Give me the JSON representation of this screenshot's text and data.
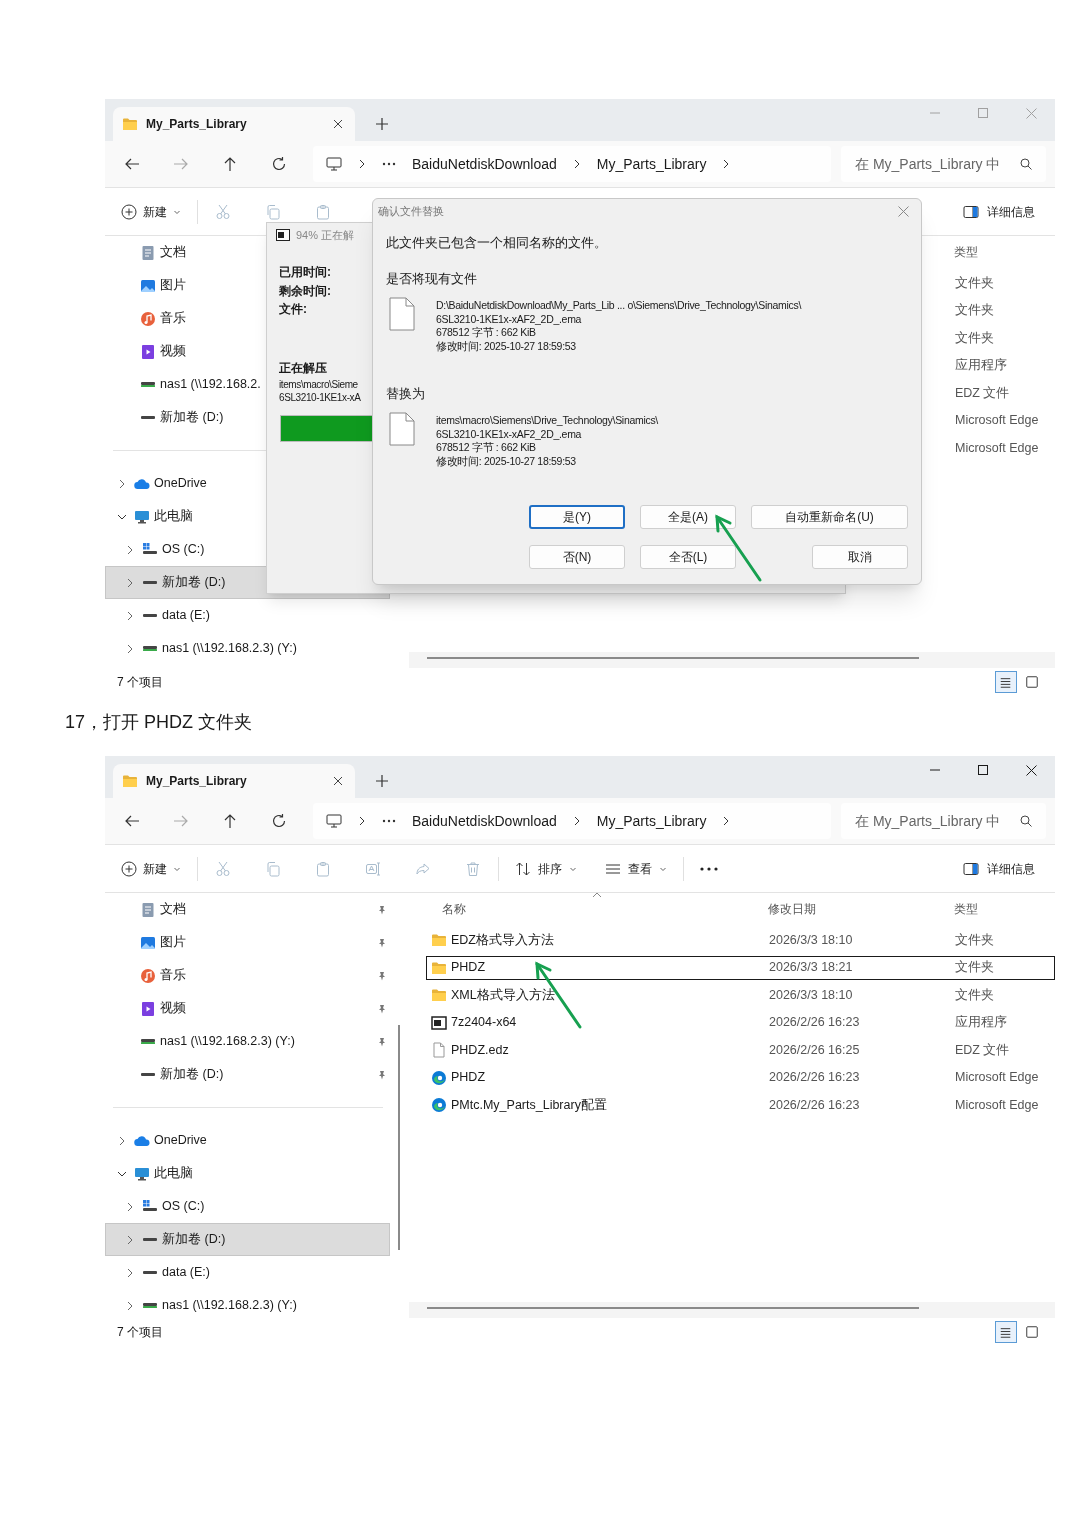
{
  "screenshot_1": {
    "active": false,
    "tab": {
      "title": "My_Parts_Library"
    },
    "breadcrumbs": [
      "BaiduNetdiskDownload",
      "My_Parts_Library"
    ],
    "search": {
      "placeholder": "在 My_Parts_Library 中"
    },
    "toolbar": {
      "new_label": "新建",
      "actions": [
        {
          "kind": "cut",
          "disabled": true
        },
        {
          "kind": "copy",
          "disabled": true
        },
        {
          "kind": "paste",
          "disabled": true
        }
      ],
      "details_label": "详细信息"
    },
    "sidebar": {
      "quick_access": [
        {
          "kind": "documents",
          "label": "文档"
        },
        {
          "kind": "pictures",
          "label": "图片"
        },
        {
          "kind": "music",
          "label": "音乐"
        },
        {
          "kind": "videos",
          "label": "视频"
        },
        {
          "kind": "network-drive",
          "label": "nas1 (\\\\192.168.2."
        },
        {
          "kind": "drive",
          "label": "新加卷 (D:)"
        }
      ],
      "tree": [
        {
          "kind": "cloud",
          "label": "OneDrive",
          "expanded": false,
          "selected": false
        },
        {
          "kind": "computer",
          "label": "此电脑",
          "expanded": true,
          "selected": false,
          "children": [
            {
              "kind": "windows-drive",
              "label": "OS (C:)",
              "expanded": false,
              "selected": false
            },
            {
              "kind": "drive",
              "label": "新加卷 (D:)",
              "expanded": false,
              "selected": true
            },
            {
              "kind": "drive",
              "label": "data (E:)",
              "expanded": false,
              "selected": false
            },
            {
              "kind": "network-drive",
              "label": "nas1 (\\\\192.168.2.3) (Y:)",
              "expanded": false,
              "selected": false
            }
          ]
        }
      ]
    },
    "columns": [
      {
        "kind": "type",
        "label": "类型",
        "sorted": false
      }
    ],
    "rows": [
      {
        "type": "文件夹",
        "selected": false
      },
      {
        "type": "文件夹",
        "selected": false
      },
      {
        "type": "文件夹",
        "selected": false
      },
      {
        "type": "应用程序",
        "selected": false
      },
      {
        "type": "EDZ 文件",
        "selected": false
      },
      {
        "type": "Microsoft Edge",
        "selected": false
      },
      {
        "type": "Microsoft Edge",
        "selected": false
      }
    ],
    "status": "7 个项目",
    "view_modes": [
      {
        "kind": "details",
        "selected": true
      },
      {
        "kind": "tiles",
        "selected": false
      }
    ],
    "progress_window": {
      "title": "94% 正在解",
      "labels": [
        "已用时间:",
        "剩余时间:",
        "文件:"
      ],
      "status": "正在解压",
      "path_lines": [
        "items\\macro\\Sieme",
        "6SL3210-1KE1x-xA"
      ],
      "level": 0.94
    },
    "confirm_dialog": {
      "title": "确认文件替换",
      "message": "此文件夹已包含一个相同名称的文件。",
      "existing_label": "是否将现有文件",
      "existing_file": [
        "D:\\BaiduNetdiskDownload\\My_Parts_Lib ... o\\Siemens\\Drive_Technology\\Sinamics\\",
        "6SL3210-1KE1x-xAF2_2D_.ema",
        "678512 字节 : 662 KiB",
        "修改时间: 2025-10-27 18:59:53"
      ],
      "replace_label": "替换为",
      "replacement_file": [
        "items\\macro\\Siemens\\Drive_Technology\\Sinamics\\",
        "6SL3210-1KE1x-xAF2_2D_.ema",
        "678512 字节 : 662 KiB",
        "修改时间: 2025-10-27 18:59:53"
      ],
      "buttons": [
        [
          {
            "label": "是(Y)",
            "default": true
          },
          {
            "label": "全是(A)",
            "default": false
          },
          {
            "label": "自动重新命名(U)",
            "default": false
          }
        ],
        [
          {
            "label": "否(N)",
            "default": false
          },
          {
            "label": "全否(L)",
            "default": false
          },
          {
            "label": "取消",
            "default": false
          }
        ]
      ]
    }
  },
  "caption": "17，打开 PHDZ 文件夹",
  "screenshot_2": {
    "active": true,
    "tab": {
      "title": "My_Parts_Library"
    },
    "breadcrumbs": [
      "BaiduNetdiskDownload",
      "My_Parts_Library"
    ],
    "search": {
      "placeholder": "在 My_Parts_Library 中"
    },
    "toolbar": {
      "new_label": "新建",
      "actions": [
        {
          "kind": "cut",
          "disabled": true
        },
        {
          "kind": "copy",
          "disabled": true
        },
        {
          "kind": "paste",
          "disabled": true
        },
        {
          "kind": "rename",
          "disabled": true
        },
        {
          "kind": "share",
          "disabled": true
        },
        {
          "kind": "delete",
          "disabled": true
        }
      ],
      "sort_label": "排序",
      "view_label": "查看",
      "details_label": "详细信息"
    },
    "sidebar": {
      "quick_access": [
        {
          "kind": "documents",
          "label": "文档",
          "pinned": true
        },
        {
          "kind": "pictures",
          "label": "图片",
          "pinned": true
        },
        {
          "kind": "music",
          "label": "音乐",
          "pinned": true
        },
        {
          "kind": "videos",
          "label": "视频",
          "pinned": true
        },
        {
          "kind": "network-drive",
          "label": "nas1 (\\\\192.168.2.3) (Y:)",
          "pinned": true
        },
        {
          "kind": "drive",
          "label": "新加卷 (D:)",
          "pinned": true
        }
      ],
      "tree": [
        {
          "kind": "cloud",
          "label": "OneDrive",
          "expanded": false,
          "selected": false
        },
        {
          "kind": "computer",
          "label": "此电脑",
          "expanded": true,
          "selected": false,
          "children": [
            {
              "kind": "windows-drive",
              "label": "OS (C:)",
              "expanded": false,
              "selected": false
            },
            {
              "kind": "drive",
              "label": "新加卷 (D:)",
              "expanded": false,
              "selected": true
            },
            {
              "kind": "drive",
              "label": "data (E:)",
              "expanded": false,
              "selected": false
            },
            {
              "kind": "network-drive",
              "label": "nas1 (\\\\192.168.2.3) (Y:)",
              "expanded": false,
              "selected": false
            }
          ]
        }
      ]
    },
    "columns": [
      {
        "kind": "name",
        "label": "名称",
        "sorted": true
      },
      {
        "kind": "date",
        "label": "修改日期",
        "sorted": false
      },
      {
        "kind": "type",
        "label": "类型",
        "sorted": false
      }
    ],
    "rows": [
      {
        "kind": "folder",
        "name": "EDZ格式导入方法",
        "date": "2026/3/3 18:10",
        "type": "文件夹",
        "selected": false
      },
      {
        "kind": "folder",
        "name": "PHDZ",
        "date": "2026/3/3 18:21",
        "type": "文件夹",
        "selected": true
      },
      {
        "kind": "folder",
        "name": "XML格式导入方法",
        "date": "2026/3/3 18:10",
        "type": "文件夹",
        "selected": false
      },
      {
        "kind": "app",
        "name": "7z2404-x64",
        "date": "2026/2/26 16:23",
        "type": "应用程序",
        "selected": false
      },
      {
        "kind": "file",
        "name": "PHDZ.edz",
        "date": "2026/2/26 16:25",
        "type": "EDZ 文件",
        "selected": false
      },
      {
        "kind": "edge",
        "name": "PHDZ",
        "date": "2026/2/26 16:23",
        "type": "Microsoft Edge",
        "selected": false
      },
      {
        "kind": "edge",
        "name": "PMtc.My_Parts_Library配置",
        "date": "2026/2/26 16:23",
        "type": "Microsoft Edge",
        "selected": false
      }
    ],
    "status": "7 个项目",
    "view_modes": [
      {
        "kind": "details",
        "selected": true
      },
      {
        "kind": "tiles",
        "selected": false
      }
    ]
  }
}
